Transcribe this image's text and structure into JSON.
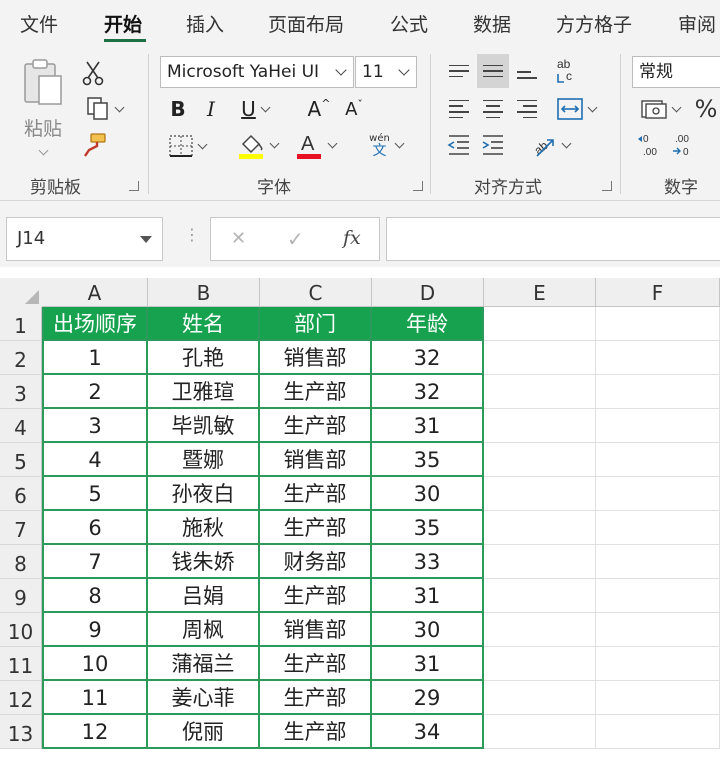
{
  "ribbon_tabs": [
    "文件",
    "开始",
    "插入",
    "页面布局",
    "公式",
    "数据",
    "方方格子",
    "审阅"
  ],
  "active_tab": "开始",
  "clipboard": {
    "paste_label": "粘贴",
    "group_label": "剪贴板"
  },
  "font": {
    "name": "Microsoft YaHei UI",
    "size": "11",
    "group_label": "字体",
    "bold": "B",
    "italic": "I",
    "underline": "U",
    "grow": "A",
    "shrink": "A",
    "phonetic_top": "wén",
    "phonetic_bottom": "文"
  },
  "alignment": {
    "group_label": "对齐方式"
  },
  "number": {
    "format": "常规",
    "group_label": "数字",
    "percent": "%"
  },
  "formula_bar": {
    "name_box": "J14",
    "fx": "fx",
    "cancel": "✕",
    "enter": "✓",
    "formula": ""
  },
  "colors": {
    "accent": "#1e7145",
    "header_fill": "#17a24f",
    "table_border": "#2c9a5b",
    "fill_color": "#ffff00",
    "font_color": "#e81123"
  },
  "grid": {
    "columns": [
      "A",
      "B",
      "C",
      "D",
      "E",
      "F"
    ],
    "rows": [
      "1",
      "2",
      "3",
      "4",
      "5",
      "6",
      "7",
      "8",
      "9",
      "10",
      "11",
      "12",
      "13"
    ],
    "header": [
      "出场顺序",
      "姓名",
      "部门",
      "年龄"
    ],
    "data": [
      [
        "1",
        "孔艳",
        "销售部",
        "32"
      ],
      [
        "2",
        "卫雅瑄",
        "生产部",
        "32"
      ],
      [
        "3",
        "毕凯敏",
        "生产部",
        "31"
      ],
      [
        "4",
        "暨娜",
        "销售部",
        "35"
      ],
      [
        "5",
        "孙夜白",
        "生产部",
        "30"
      ],
      [
        "6",
        "施秋",
        "生产部",
        "35"
      ],
      [
        "7",
        "钱朱娇",
        "财务部",
        "33"
      ],
      [
        "8",
        "吕娟",
        "生产部",
        "31"
      ],
      [
        "9",
        "周枫",
        "销售部",
        "30"
      ],
      [
        "10",
        "蒲福兰",
        "生产部",
        "31"
      ],
      [
        "11",
        "姜心菲",
        "生产部",
        "29"
      ],
      [
        "12",
        "倪丽",
        "生产部",
        "34"
      ]
    ]
  }
}
